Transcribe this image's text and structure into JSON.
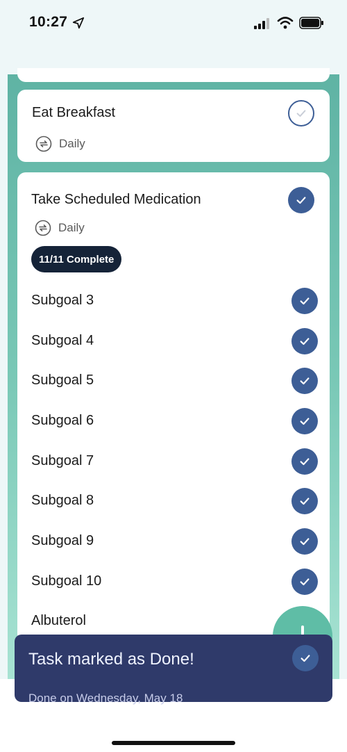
{
  "status_bar": {
    "time": "10:27"
  },
  "tasks": [
    {
      "title": "Eat Breakfast",
      "repeat": "Daily",
      "done": false
    },
    {
      "title": "Take Scheduled Medication",
      "repeat": "Daily",
      "done": true,
      "badge": "11/11 Complete",
      "subgoals": [
        {
          "label": "Subgoal 3",
          "done": true
        },
        {
          "label": "Subgoal 4",
          "done": true
        },
        {
          "label": "Subgoal 5",
          "done": true
        },
        {
          "label": "Subgoal 6",
          "done": true
        },
        {
          "label": "Subgoal 7",
          "done": true
        },
        {
          "label": "Subgoal 8",
          "done": true
        },
        {
          "label": "Subgoal 9",
          "done": true
        },
        {
          "label": "Subgoal 10",
          "done": true
        },
        {
          "label": "Albuterol",
          "done": true
        }
      ]
    }
  ],
  "toast": {
    "title": "Task marked as Done!",
    "subtitle": "Done on Wednesday, May 18"
  },
  "icons": {
    "location": "location-arrow-icon",
    "signal": "cellular-signal-icon",
    "wifi": "wifi-icon",
    "battery": "battery-icon",
    "repeat": "repeat-icon",
    "check": "checkmark-icon",
    "add": "plus-icon"
  },
  "colors": {
    "accent": "#3d5e96",
    "teal": "#5fb3a4",
    "toast_bg": "#2f3a6a",
    "badge_bg": "#152338",
    "fab": "#5fbda6"
  }
}
